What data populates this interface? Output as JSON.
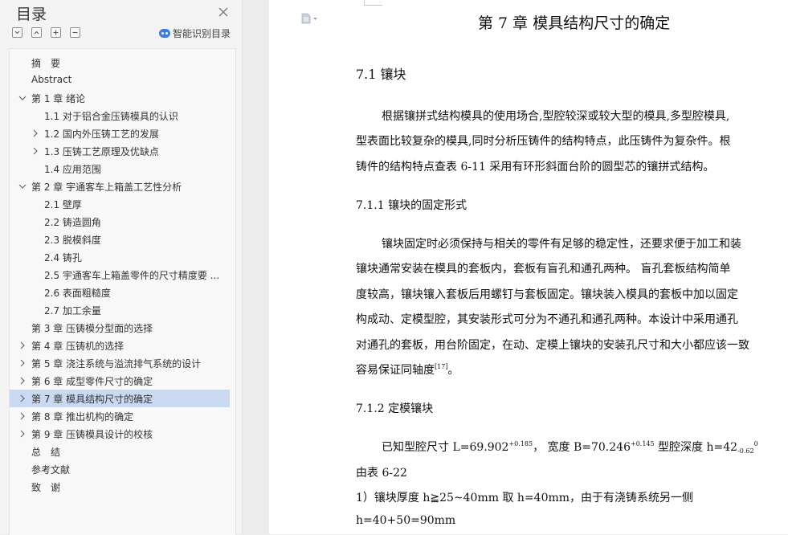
{
  "toc": {
    "title": "目录",
    "smart_label": "智能识别目录",
    "items": [
      {
        "label": "摘　要"
      },
      {
        "label": "Abstract"
      },
      {
        "label": "第 1 章  绪论"
      },
      {
        "label": "1.1  对于铝合金压铸模具的认识"
      },
      {
        "label": "1.2  国内外压铸工艺的发展"
      },
      {
        "label": "1.3  压铸工艺原理及优缺点"
      },
      {
        "label": "1.4  应用范围"
      },
      {
        "label": "第 2 章  宇通客车上箱盖工艺性分析"
      },
      {
        "label": "2.1 壁厚"
      },
      {
        "label": "2.2 铸造圆角"
      },
      {
        "label": "2.3 脱模斜度"
      },
      {
        "label": "2.4 铸孔"
      },
      {
        "label": "2.5 宇通客车上箱盖零件的尺寸精度要 ..."
      },
      {
        "label": "2.6 表面粗糙度"
      },
      {
        "label": "2.7 加工余量"
      },
      {
        "label": "第 3 章  压铸模分型面的选择"
      },
      {
        "label": "第 4 章  压铸机的选择"
      },
      {
        "label": "第 5 章  浇注系统与溢流排气系统的设计"
      },
      {
        "label": "第 6 章  成型零件尺寸的确定"
      },
      {
        "label": "第 7 章  模具结构尺寸的确定"
      },
      {
        "label": "第 8 章  推出机构的确定"
      },
      {
        "label": "第 9 章  压铸模具设计的校核"
      },
      {
        "label": "总　结"
      },
      {
        "label": "参考文献"
      },
      {
        "label": "致　谢"
      }
    ]
  },
  "doc": {
    "chapter_title": "第 7 章  模具结构尺寸的确定",
    "sec_7_1": "7.1  镶块",
    "p1_l1": "根据镶拼式结构模具的使用场合,型腔较深或较大型的模具,多型腔模具,",
    "p1_l2": "型表面比较复杂的模具,同时分析压铸件的结构特点，此压铸件为复杂件。根",
    "p1_l3": "铸件的结构特点查表 6-11 采用有环形斜面台阶的圆型芯的镶拼式结构。",
    "sec_7_1_1": "7.1.1  镶块的固定形式",
    "p2_l1": "镶块固定时必须保持与相关的零件有足够的稳定性，还要求便于加工和装",
    "p2_l2": "镶块通常安装在模具的套板内，套板有盲孔和通孔两种。 盲孔套板结构简单",
    "p2_l3": "度较高，镶块镶入套板后用螺钉与套板固定。镶块装入模具的套板中加以固定",
    "p2_l4": "构成动、定模型腔，其安装形式可分为不通孔和通孔两种。本设计中采用通孔",
    "p2_l5": "对通孔的套板，用台阶固定，在动、定模上镶块的安装孔尺寸和大小都应该一致",
    "p2_l6_a": "容易保证同轴度",
    "p2_l6_ref": "[17]",
    "p2_l6_b": "。",
    "sec_7_1_2": "7.1.2  定模镶块",
    "p3_a": "已知型腔尺寸 L=69.902",
    "p3_a_sup": "+0.185",
    "p3_b": "，  宽度 B=70.246",
    "p3_b_sup": "+0.145",
    "p3_c": "   型腔深度 h=42",
    "p3_c_sub": "-0.62",
    "p3_c_sup": "0",
    "p4": "由表 6-22",
    "p5": "1）镶块厚度   h≧25~40mm   取 h=40mm，由于有浇铸系统另一侧",
    "p6": "h=40+50=90mm"
  }
}
